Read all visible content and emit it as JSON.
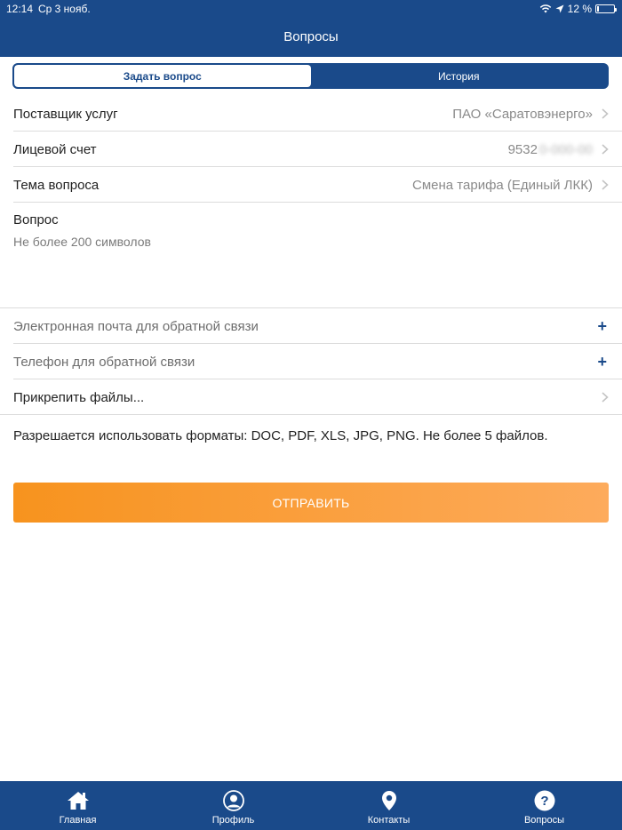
{
  "status_bar": {
    "time": "12:14",
    "date": "Ср 3 нояб.",
    "battery": "12 %",
    "battery_level": 0.12
  },
  "header": {
    "title": "Вопросы"
  },
  "segments": [
    {
      "label": "Задать вопрос",
      "active": true
    },
    {
      "label": "История",
      "active": false
    }
  ],
  "form": {
    "provider": {
      "label": "Поставщик услуг",
      "value": "ПАО «Саратовэнерго»"
    },
    "account": {
      "label": "Лицевой счет",
      "value": "9532",
      "value_hidden": "0-000-00"
    },
    "topic": {
      "label": "Тема вопроса",
      "value": "Смена тарифа (Единый ЛКК)"
    },
    "question": {
      "label": "Вопрос",
      "placeholder": "Не более 200 символов"
    },
    "email": {
      "label": "Электронная почта для обратной связи"
    },
    "phone": {
      "label": "Телефон для обратной связи"
    },
    "attach": {
      "label": "Прикрепить файлы..."
    },
    "formats_note": "Разрешается использовать форматы: DOC, PDF, XLS, JPG, PNG. Не более 5 файлов.",
    "submit_label": "ОТПРАВИТЬ"
  },
  "tabbar": [
    {
      "label": "Главная",
      "icon": "home-icon"
    },
    {
      "label": "Профиль",
      "icon": "profile-icon"
    },
    {
      "label": "Контакты",
      "icon": "location-pin-icon"
    },
    {
      "label": "Вопросы",
      "icon": "question-icon"
    }
  ],
  "colors": {
    "primary": "#1a4a8a",
    "accent_start": "#f7931e",
    "accent_end": "#fdab5c"
  }
}
